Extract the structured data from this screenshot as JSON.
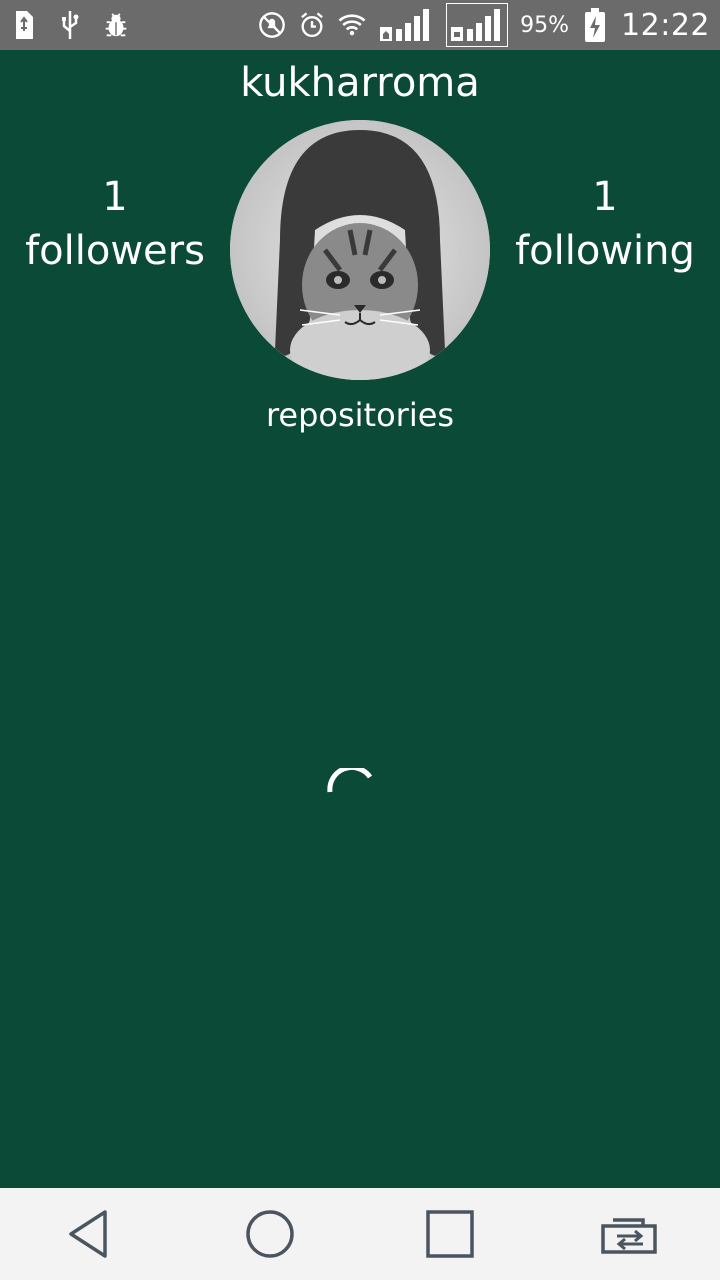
{
  "status_bar": {
    "icons_left": [
      "sim-card-icon",
      "usb-icon",
      "bug-icon"
    ],
    "icons_right": [
      "do-not-disturb-icon",
      "alarm-icon",
      "wifi-icon",
      "signal-icon",
      "signal-icon-2",
      "battery-charging-icon"
    ],
    "battery_percent": "95%",
    "time": "12:22"
  },
  "profile": {
    "username": "kukharroma",
    "followers_count": "1",
    "followers_label": "followers",
    "following_count": "1",
    "following_label": "following",
    "repositories_label": "repositories"
  },
  "nav_bar": {
    "buttons": [
      "back-icon",
      "home-icon",
      "recents-icon",
      "switch-app-icon"
    ]
  },
  "colors": {
    "background": "#0a4a36",
    "status_bar": "#6b6b6b",
    "nav_bar": "#f3f3f3",
    "text": "#ffffff",
    "nav_icon": "#4a5560"
  }
}
